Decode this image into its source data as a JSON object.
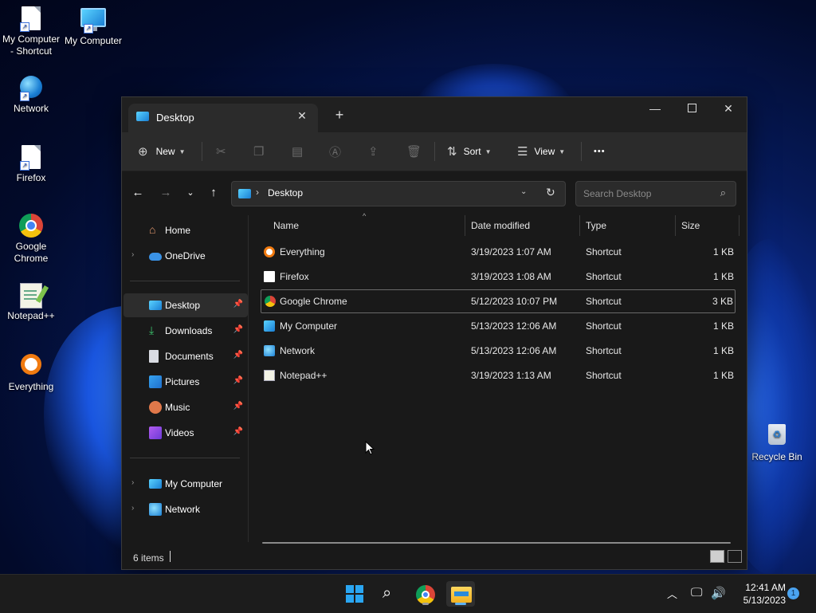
{
  "desktop": {
    "icons": [
      {
        "label": "My Computer - Shortcut"
      },
      {
        "label": "My Computer"
      },
      {
        "label": "Network"
      },
      {
        "label": "Firefox"
      },
      {
        "label": "Google Chrome"
      },
      {
        "label": "Notepad++"
      },
      {
        "label": "Everything"
      },
      {
        "label": "Recycle Bin"
      }
    ]
  },
  "window": {
    "tab_title": "Desktop",
    "toolbar": {
      "new_label": "New",
      "sort_label": "Sort",
      "view_label": "View",
      "more_label": "•••"
    },
    "address": {
      "path": "Desktop",
      "separator": "›"
    },
    "search": {
      "placeholder": "Search Desktop"
    },
    "nav": {
      "items": [
        {
          "label": "Home"
        },
        {
          "label": "OneDrive"
        },
        {
          "label": "Desktop"
        },
        {
          "label": "Downloads"
        },
        {
          "label": "Documents"
        },
        {
          "label": "Pictures"
        },
        {
          "label": "Music"
        },
        {
          "label": "Videos"
        },
        {
          "label": "My Computer"
        },
        {
          "label": "Network"
        }
      ]
    },
    "columns": {
      "name": "Name",
      "date": "Date modified",
      "type": "Type",
      "size": "Size"
    },
    "files": [
      {
        "name": "Everything",
        "date": "3/19/2023 1:07 AM",
        "type": "Shortcut",
        "size": "1 KB",
        "icon": "everything-icon"
      },
      {
        "name": "Firefox",
        "date": "3/19/2023 1:08 AM",
        "type": "Shortcut",
        "size": "1 KB",
        "icon": "shortcut-file-icon"
      },
      {
        "name": "Google Chrome",
        "date": "5/12/2023 10:07 PM",
        "type": "Shortcut",
        "size": "3 KB",
        "icon": "chrome-icon"
      },
      {
        "name": "My Computer",
        "date": "5/13/2023 12:06 AM",
        "type": "Shortcut",
        "size": "1 KB",
        "icon": "computer-icon"
      },
      {
        "name": "Network",
        "date": "5/13/2023 12:06 AM",
        "type": "Shortcut",
        "size": "1 KB",
        "icon": "network-icon"
      },
      {
        "name": "Notepad++",
        "date": "3/19/2023 1:13 AM",
        "type": "Shortcut",
        "size": "1 KB",
        "icon": "notepadpp-icon"
      }
    ],
    "selected_file": "Google Chrome",
    "status": {
      "item_count": "6 items"
    }
  },
  "taskbar": {
    "time": "12:41 AM",
    "date": "5/13/2023",
    "notification_count": "1"
  },
  "colors": {
    "accent": "#2aa6f2",
    "window_bg": "#191919",
    "toolbar_bg": "#2b2b2b"
  }
}
